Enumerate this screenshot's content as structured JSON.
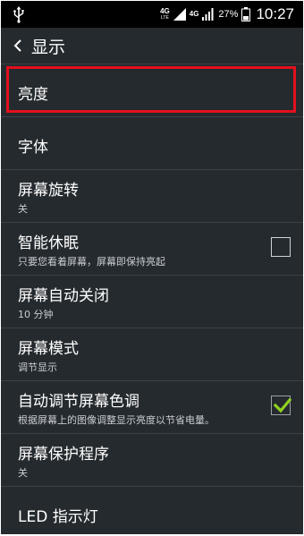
{
  "status_bar": {
    "network_type": "4G",
    "network_sub": "LTE",
    "signal2_label": "4G",
    "battery_percent": "27%",
    "time": "10:27"
  },
  "header": {
    "title": "显示"
  },
  "items": [
    {
      "title": "亮度",
      "summary": ""
    },
    {
      "title": "字体",
      "summary": ""
    },
    {
      "title": "屏幕旋转",
      "summary": "关"
    },
    {
      "title": "智能休眠",
      "summary": "只要您看着屏幕，屏幕即保持亮起",
      "checked": false
    },
    {
      "title": "屏幕自动关闭",
      "summary": "10 分钟"
    },
    {
      "title": "屏幕模式",
      "summary": "调节显示"
    },
    {
      "title": "自动调节屏幕色调",
      "summary": "根据屏幕上的图像调整显示亮度以节省电量。",
      "checked": true
    },
    {
      "title": "屏幕保护程序",
      "summary": "关"
    },
    {
      "title": "LED 指示灯",
      "summary": ""
    }
  ],
  "colors": {
    "background": "#252a2e",
    "status_bar": "#000000",
    "highlight": "#e3101d",
    "check_mark": "#8fd11e"
  }
}
